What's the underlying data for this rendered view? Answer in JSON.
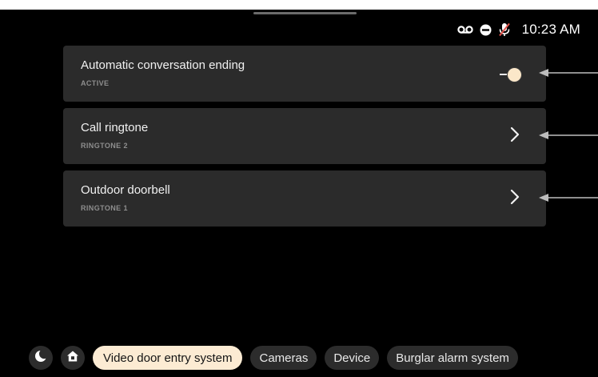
{
  "status_bar": {
    "time": "10:23 AM",
    "icons": [
      "voicemail-icon",
      "do-not-disturb-icon",
      "microphone-muted-icon"
    ]
  },
  "settings": [
    {
      "title": "Automatic conversation ending",
      "subtitle": "ACTIVE",
      "control": "toggle",
      "enabled": true
    },
    {
      "title": "Call ringtone",
      "subtitle": "RINGTONE 2",
      "control": "chevron"
    },
    {
      "title": "Outdoor doorbell",
      "subtitle": "RINGTONE 1",
      "control": "chevron"
    }
  ],
  "bottom_nav": {
    "icons": [
      "night-mode-icon",
      "home-icon"
    ],
    "tabs": [
      {
        "label": "Video door entry system",
        "active": true
      },
      {
        "label": "Cameras",
        "active": false
      },
      {
        "label": "Device",
        "active": false
      },
      {
        "label": "Burglar alarm system",
        "active": false
      }
    ]
  },
  "colors": {
    "background": "#000000",
    "card": "#2b2b2b",
    "accent": "#fcebd3",
    "subtitle": "#8e8e8e"
  }
}
